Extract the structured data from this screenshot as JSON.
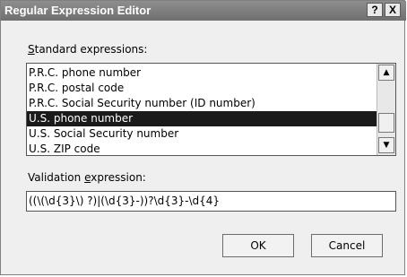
{
  "window": {
    "title": "Regular Expression Editor",
    "help_label": "?",
    "close_label": "X"
  },
  "standard": {
    "label_pre": "",
    "label_key": "S",
    "label_post": "tandard expressions:",
    "items": [
      {
        "label": "P.R.C. phone number"
      },
      {
        "label": "P.R.C. postal code"
      },
      {
        "label": "P.R.C. Social Security number (ID number)"
      },
      {
        "label": "U.S. phone number"
      },
      {
        "label": "U.S. Social Security number"
      },
      {
        "label": "U.S. ZIP code"
      }
    ],
    "selected_label": "U.S. phone number"
  },
  "validation": {
    "label_pre": "Validation ",
    "label_key": "e",
    "label_post": "xpression:",
    "value": "((\\(\\d{3}\\) ?)|(\\d{3}-))?\\d{3}-\\d{4}"
  },
  "buttons": {
    "ok_label": "OK",
    "cancel_label": "Cancel"
  },
  "icons": {
    "scroll_up": "scroll-up-arrow-icon",
    "scroll_down": "scroll-down-arrow-icon"
  }
}
